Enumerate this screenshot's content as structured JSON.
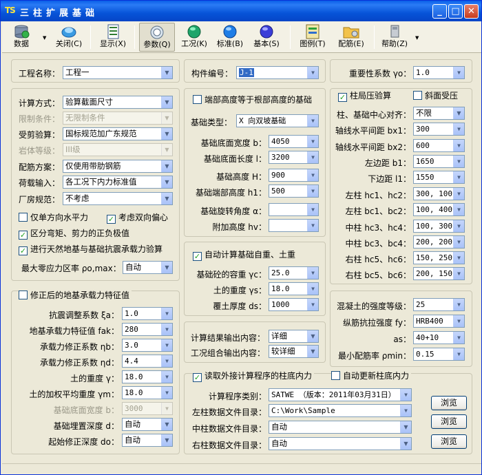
{
  "title": {
    "logo": "TS",
    "text": "三柱扩展基础"
  },
  "toolbar": [
    {
      "label": "数据",
      "underline": "(D)",
      "icon": "database-icon"
    },
    {
      "label": "关闭(C)",
      "icon": "close-gear-icon"
    },
    {
      "label": "显示(X)",
      "icon": "document-icon"
    },
    {
      "label": "参数(Q)",
      "icon": "parameter-icon"
    },
    {
      "label": "工况(K)",
      "icon": "green-ball-icon"
    },
    {
      "label": "标准(B)",
      "icon": "blue-ball-icon"
    },
    {
      "label": "基本(S)",
      "icon": "purple-ball-icon"
    },
    {
      "label": "图例(T)",
      "icon": "legend-icon"
    },
    {
      "label": "配筋(E)",
      "icon": "folder-gear-icon"
    },
    {
      "label": "帮助(Z)",
      "icon": "help-icon"
    }
  ],
  "top": {
    "project_label": "工程名称：",
    "project_value": "工程一",
    "member_label": "构件编号：",
    "member_value": "J-1",
    "importance_label": "重要性系数 γo：",
    "importance_value": "1.0"
  },
  "calc": {
    "method_label": "计算方式：",
    "method_value": "验算截面尺寸",
    "limit_label": "限制条件：",
    "limit_value": "无限制条件",
    "shear_label": "受剪验算：",
    "shear_value": "国标规范加广东规范",
    "rock_label": "岩体等级：",
    "rock_value": "III级",
    "rebar_label": "配筋方案：",
    "rebar_value": "仅使用带肋钢筋",
    "load_label": "荷载输入：",
    "load_value": "各工况下内力标准值",
    "factory_label": "厂房规范：",
    "factory_value": "不考虑",
    "chk_single": "仅单方向水平力",
    "chk_biaxial": "考虑双向偏心",
    "chk_sign": "区分弯矩、剪力的正负极值",
    "chk_seismic": "进行天然地基与基础抗震承载力验算",
    "zero_label": "最大零应力区率 ρo,max：",
    "zero_value": "自动"
  },
  "foundation": {
    "chk_end": "端部高度等于根部高度的基础",
    "type_label": "基础类型：",
    "type_value": "X 向双坡基础",
    "width_label": "基础底面宽度 b：",
    "width_value": "4050",
    "length_label": "基础底面长度 l：",
    "length_value": "3200",
    "height_label": "基础高度 H：",
    "height_value": "900",
    "end_label": "基础端部高度 h1：",
    "end_value": "500",
    "rot_label": "基础旋转角度 α：",
    "rot_value": "",
    "extra_label": "附加高度 hv：",
    "extra_value": ""
  },
  "selfweight": {
    "chk": "自动计算基础自重、土重",
    "conc_label": "基础砼的容重 γc：",
    "conc_value": "25.0",
    "soil_label": "土的重度 γs：",
    "soil_value": "18.0",
    "cover_label": "覆土厚度 ds：",
    "cover_value": "1000"
  },
  "output": {
    "result_label": "计算结果输出内容：",
    "result_value": "详细",
    "combo_label": "工况组合输出内容：",
    "combo_value": "较详细"
  },
  "column": {
    "chk_local": "柱局压验算",
    "chk_slope": "斜面受压",
    "align_label": "柱、基础中心对齐：",
    "align_value": "不限",
    "bx1_label": "轴线水平间距 bx1：",
    "bx1_value": "300",
    "bx2_label": "轴线水平间距 bx2：",
    "bx2_value": "600",
    "b1_label": "左边距 b1：",
    "b1_value": "1650",
    "l1_label": "下边距 l1：",
    "l1_value": "1550",
    "hc12_label": "左柱 hc1、hc2：",
    "hc12_value": "300, 100",
    "bc12_label": "左柱 bc1、bc2：",
    "bc12_value": "100, 400",
    "hc34_label": "中柱 hc3、hc4：",
    "hc34_value": "100, 300",
    "bc34_label": "中柱 bc3、bc4：",
    "bc34_value": "200, 200",
    "hc56_label": "右柱 hc5、hc6：",
    "hc56_value": "150, 250",
    "bc56_label": "右柱 bc5、bc6：",
    "bc56_value": "200, 150"
  },
  "material": {
    "conc_label": "混凝土的强度等级：",
    "conc_value": "25",
    "fy_label": "纵筋抗拉强度 fy：",
    "fy_value": "HRB400",
    "as_label": "as：",
    "as_value": "40+10",
    "rho_label": "最小配筋率 ρmin：",
    "rho_value": "0.15"
  },
  "bearing": {
    "chk": "修正后的地基承载力特征值",
    "za_label": "抗震调整系数 ξa：",
    "za_value": "1.0",
    "fak_label": "地基承载力特征值 fak：",
    "fak_value": "280",
    "nb_label": "承载力修正系数 ηb：",
    "nb_value": "3.0",
    "nd_label": "承载力修正系数 ηd：",
    "nd_value": "4.4",
    "gamma_label": "土的重度 γ：",
    "gamma_value": "18.0",
    "gm_label": "土的加权平均重度 γm：",
    "gm_value": "18.0",
    "bw_label": "基础底面宽度 b：",
    "bw_value": "3000",
    "d_label": "基础埋置深度 d：",
    "d_value": "自动",
    "do_label": "起始修正深度 do：",
    "do_value": "自动"
  },
  "external": {
    "chk_read": "读取外接计算程序的柱底内力",
    "chk_auto": "自动更新柱底内力",
    "prog_label": "计算程序类别：",
    "prog_value": "SATWE （版本：2011年03月31日）",
    "left_label": "左柱数据文件目录：",
    "left_value": "C:\\Work\\Sample",
    "mid_label": "中柱数据文件目录：",
    "mid_value": "自动",
    "right_label": "右柱数据文件目录：",
    "right_value": "自动",
    "browse": "浏览"
  }
}
